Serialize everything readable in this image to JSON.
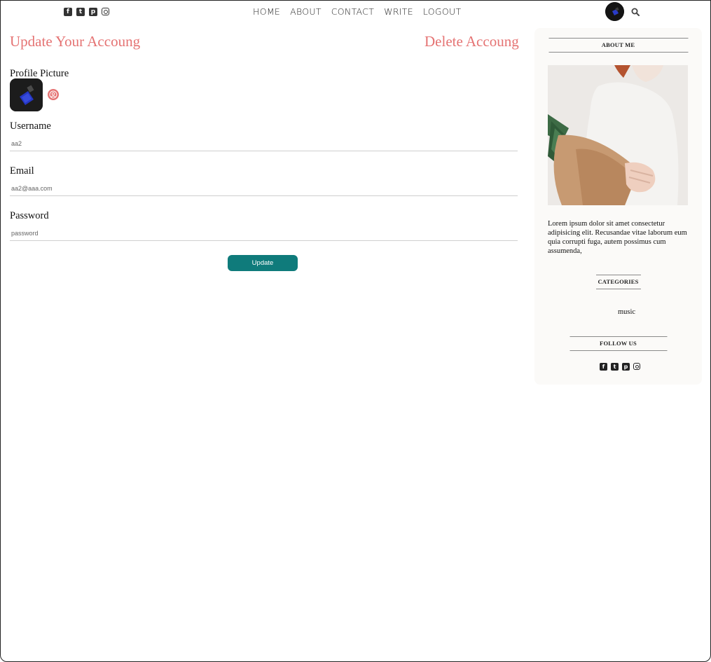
{
  "topbar": {
    "social_icons": [
      "facebook-square-icon",
      "twitter-square-icon",
      "pinterest-square-icon",
      "instagram-icon"
    ],
    "nav": [
      "HOME",
      "ABOUT",
      "CONTACT",
      "WRITE",
      "LOGOUT"
    ],
    "search_icon": "search-icon"
  },
  "main": {
    "update_title": "Update Your Accoung",
    "delete_title": "Delete Accoung",
    "profile_picture_label": "Profile Picture",
    "profile_upload_icon": "user-circle-icon",
    "username_label": "Username",
    "username_placeholder": "aa2",
    "email_label": "Email",
    "email_placeholder": "aa2@aaa.com",
    "password_label": "Password",
    "password_placeholder": "password",
    "update_button": "Update"
  },
  "sidebar": {
    "about_title": "ABOUT ME",
    "about_text": "Lorem ipsum dolor sit amet consectetur adipisicing elit. Recusandae vitae laborum eum quia corrupti fuga, autem possimus cum assumenda,",
    "categories_title": "CATEGORIES",
    "categories": [
      "music"
    ],
    "follow_title": "FOLLOW US"
  },
  "colors": {
    "accent": "#e57373",
    "button": "#0f7b7b",
    "sidebar_bg": "#fbfaf8"
  }
}
